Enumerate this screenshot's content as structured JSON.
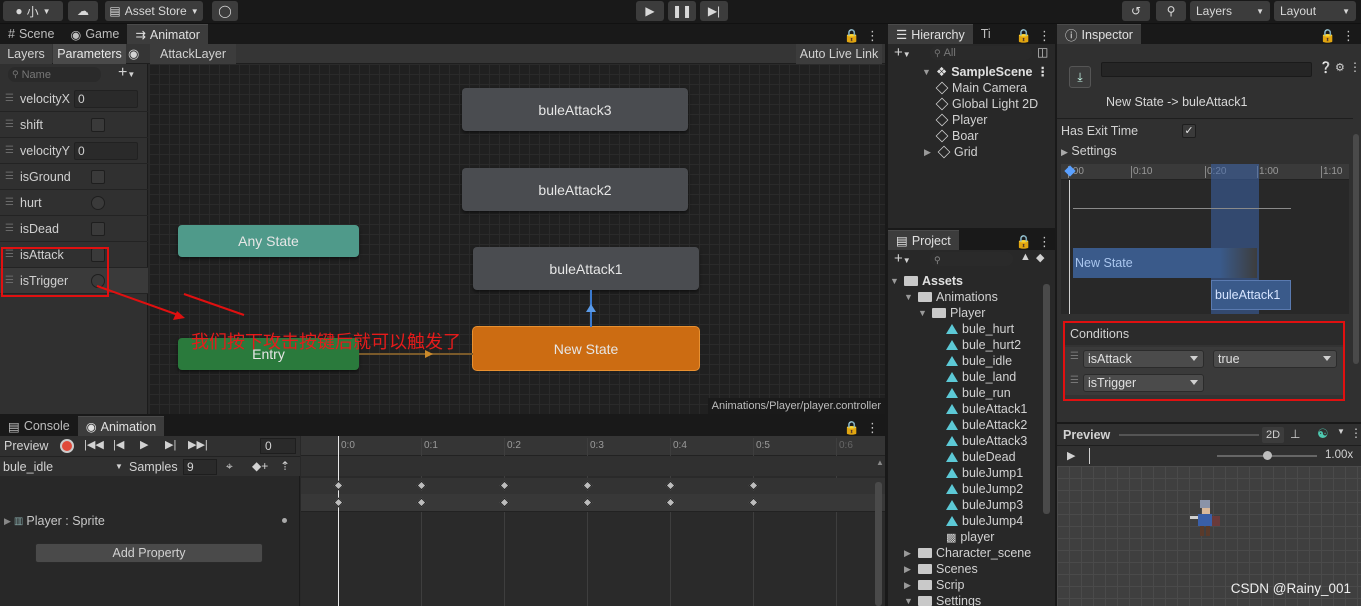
{
  "toolbar": {
    "account_label": "小",
    "asset_store_label": "Asset Store",
    "layers_label": "Layers",
    "layout_label": "Layout"
  },
  "scene_tabs": {
    "scene": "Scene",
    "game": "Game",
    "animator": "Animator"
  },
  "animator": {
    "layers_tab": "Layers",
    "parameters_tab": "Parameters",
    "breadcrumb": "AttackLayer",
    "auto_live_link": "Auto Live Link",
    "search_placeholder": "Name",
    "footer_path": "Animations/Player/player.controller",
    "parameters": [
      {
        "name": "velocityX",
        "type": "float",
        "value": "0"
      },
      {
        "name": "shift",
        "type": "bool"
      },
      {
        "name": "velocityY",
        "type": "float",
        "value": "0"
      },
      {
        "name": "isGround",
        "type": "bool"
      },
      {
        "name": "hurt",
        "type": "trigger"
      },
      {
        "name": "isDead",
        "type": "bool"
      },
      {
        "name": "isAttack",
        "type": "bool"
      },
      {
        "name": "isTrigger",
        "type": "trigger"
      }
    ],
    "states": {
      "any_state": "Any State",
      "entry": "Entry",
      "new_state": "New State",
      "bule_attack1": "buleAttack1",
      "bule_attack2": "buleAttack2",
      "bule_attack3": "buleAttack3"
    },
    "annotation": "我们按下攻击按键后就可以触发了"
  },
  "hierarchy": {
    "tab_label": "Hierarchy",
    "tab2_label": "Ti",
    "search_placeholder": "All",
    "scene_name": "SampleScene",
    "items": [
      "Main Camera",
      "Global Light 2D",
      "Player",
      "Boar",
      "Grid"
    ]
  },
  "project": {
    "tab_label": "Project",
    "root": "Assets",
    "animations": "Animations",
    "player_folder": "Player",
    "clips": [
      "bule_hurt",
      "bule_hurt2",
      "bule_idle",
      "bule_land",
      "bule_run",
      "buleAttack1",
      "buleAttack2",
      "buleAttack3",
      "buleDead",
      "buleJump1",
      "buleJump2",
      "buleJump3",
      "buleJump4"
    ],
    "controller": "player",
    "folders": [
      "Character_scene",
      "Scenes",
      "Scrip",
      "Settings"
    ]
  },
  "inspector": {
    "tab_label": "Inspector",
    "transition_title": "New State -> buleAttack1",
    "has_exit_time_label": "Has Exit Time",
    "has_exit_time": true,
    "settings_label": "Settings",
    "timeline_ticks": [
      ":00",
      "0:10",
      "0:20",
      "1:00",
      "1:10"
    ],
    "timeline_source": "New State",
    "timeline_dest": "buleAttack1",
    "conditions_label": "Conditions",
    "conditions": [
      {
        "param": "isAttack",
        "value": "true"
      },
      {
        "param": "isTrigger",
        "value": ""
      }
    ],
    "preview_label": "Preview",
    "preview_2d": "2D",
    "preview_speed": "1.00x"
  },
  "bottom_tabs": {
    "console": "Console",
    "animation": "Animation"
  },
  "animation": {
    "preview_label": "Preview",
    "frame": "0",
    "clip": "bule_idle",
    "samples_label": "Samples",
    "samples": "9",
    "property": "Player : Sprite",
    "add_property": "Add Property",
    "ticks": [
      "0:0",
      "0:1",
      "0:2",
      "0:3",
      "0:4",
      "0:5",
      "0:6"
    ]
  },
  "watermark": "CSDN @Rainy_001",
  "colors": {
    "any_state": "#4f9a8a",
    "entry": "#2a7a3c",
    "new_state": "#cc6c12",
    "state_gray": "#4a4c50",
    "highlight_red": "#e01010",
    "selection_blue": "#3a5a8a"
  }
}
